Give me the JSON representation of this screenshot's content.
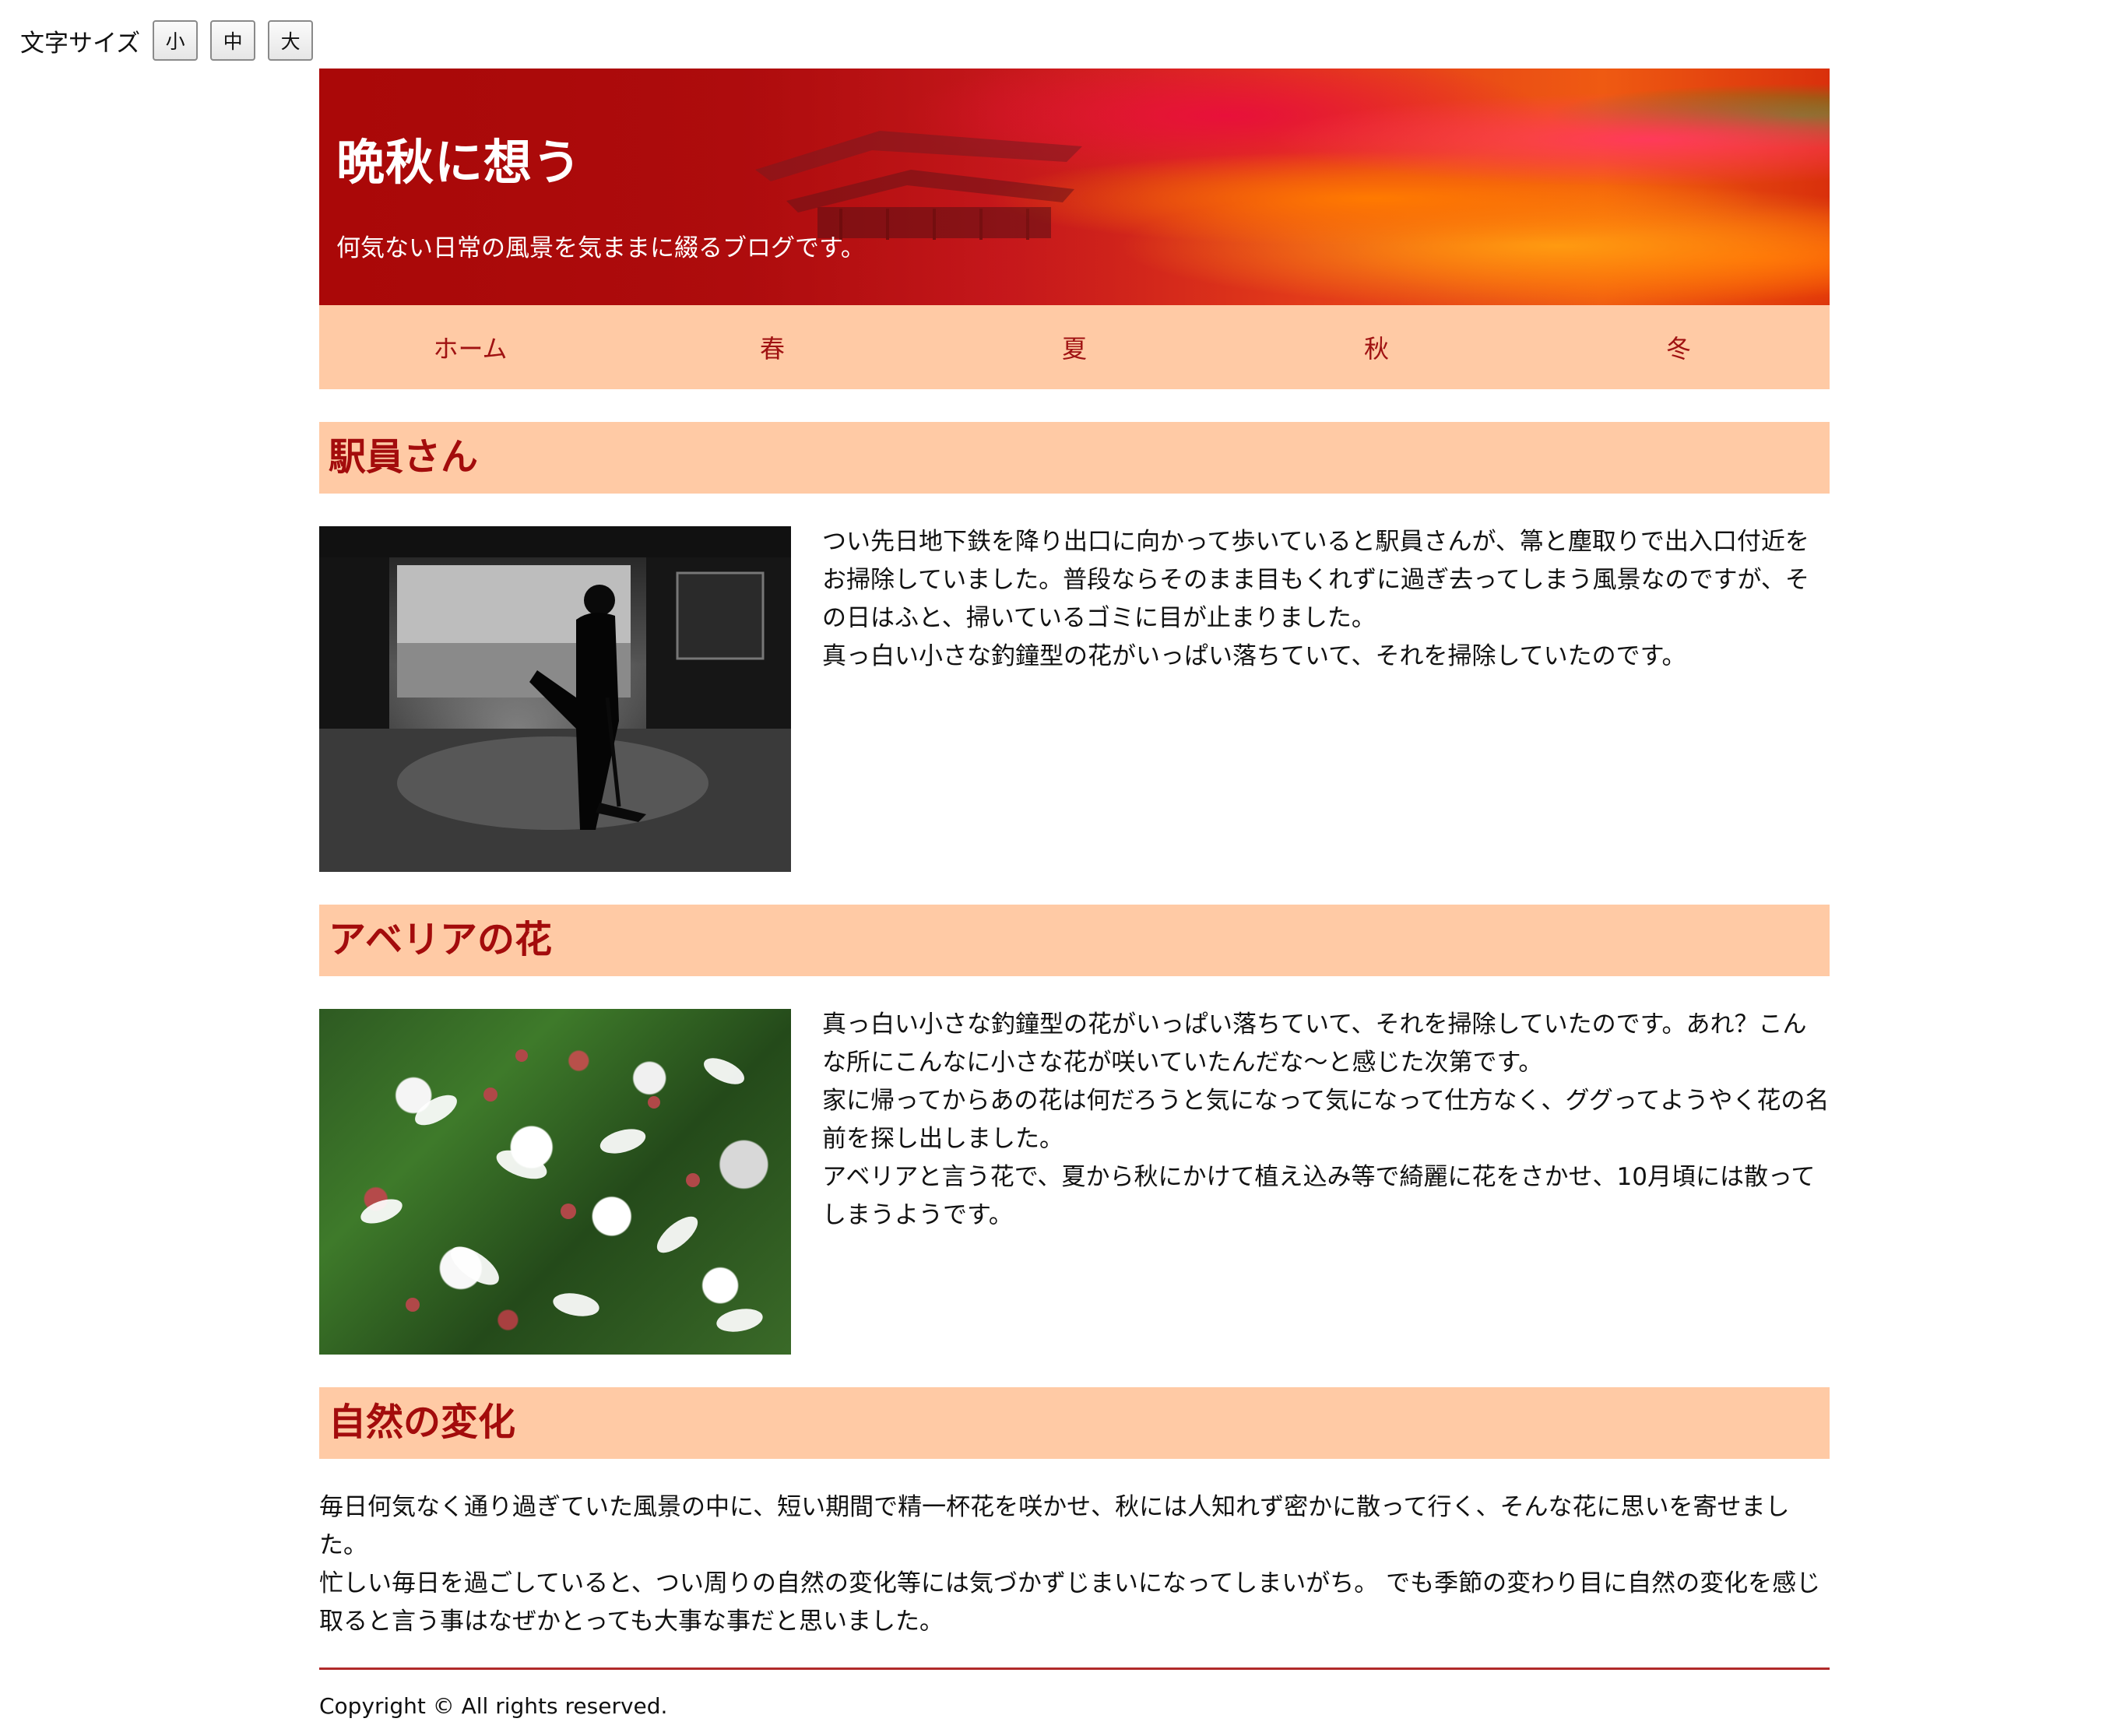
{
  "font_size_control": {
    "label": "文字サイズ",
    "small": "小",
    "medium": "中",
    "large": "大"
  },
  "header": {
    "title": "晩秋に想う",
    "subtitle": "何気ない日常の風景を気ままに綴るブログです。"
  },
  "nav": {
    "items": [
      "ホーム",
      "春",
      "夏",
      "秋",
      "冬"
    ]
  },
  "sections": [
    {
      "heading": "駅員さん",
      "paragraphs": [
        "つい先日地下鉄を降り出口に向かって歩いていると駅員さんが、箒と塵取りで出入口付近をお掃除していました。普段ならそのまま目もくれずに過ぎ去ってしまう風景なのですが、その日はふと、掃いているゴミに目が止まりました。",
        "真っ白い小さな釣鐘型の花がいっぱい落ちていて、それを掃除していたのです。"
      ]
    },
    {
      "heading": "アベリアの花",
      "paragraphs": [
        "真っ白い小さな釣鐘型の花がいっぱい落ちていて、それを掃除していたのです。あれ？こんな所にこんなに小さな花が咲いていたんだな～と感じた次第です。",
        "家に帰ってからあの花は何だろうと気になって気になって仕方なく、ググってようやく花の名前を探し出しました。",
        "アベリアと言う花で、夏から秋にかけて植え込み等で綺麗に花をさかせ、10月頃には散ってしまうようです。"
      ]
    },
    {
      "heading": "自然の変化",
      "paragraphs": [
        "毎日何気なく通り過ぎていた風景の中に、短い期間で精一杯花を咲かせ、秋には人知れず密かに散って行く、そんな花に思いを寄せました。",
        "忙しい毎日を過ごしていると、つい周りの自然の変化等には気づかずじまいになってしまいがち。 でも季節の変わり目に自然の変化を感じ取ると言う事はなぜかとっても大事な事だと思いました。"
      ]
    }
  ],
  "footer": {
    "copyright": "Copyright © All rights reserved."
  },
  "colors": {
    "nav_background": "#ffcaa5",
    "heading_text": "#a30c0c",
    "nav_text": "#a01212",
    "rule": "#b02a2a"
  }
}
